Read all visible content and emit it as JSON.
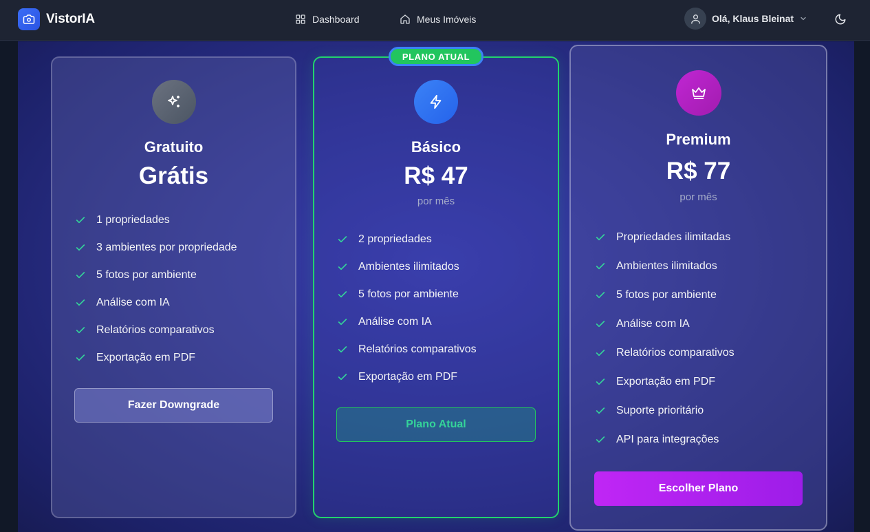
{
  "app": {
    "name": "VistorIA"
  },
  "nav": {
    "links": [
      {
        "label": "Dashboard",
        "icon": "grid-icon"
      },
      {
        "label": "Meus Imóveis",
        "icon": "home-icon"
      }
    ],
    "user": {
      "greeting": "Olá, Klaus Bleinat",
      "icon": "user-icon"
    },
    "theme_icon": "moon-icon"
  },
  "plans": [
    {
      "id": "free",
      "name": "Gratuito",
      "price": "Grátis",
      "period": "",
      "icon": "sparkles-icon",
      "features": [
        "1 propriedades",
        "3 ambientes por propriedade",
        "5 fotos por ambiente",
        "Análise com IA",
        "Relatórios comparativos",
        "Exportação em PDF"
      ],
      "button_label": "Fazer Downgrade"
    },
    {
      "id": "basic",
      "name": "Básico",
      "price": "R$ 47",
      "period": "por mês",
      "icon": "lightning-icon",
      "badge": "PLANO ATUAL",
      "features": [
        "2 propriedades",
        "Ambientes ilimitados",
        "5 fotos por ambiente",
        "Análise com IA",
        "Relatórios comparativos",
        "Exportação em PDF"
      ],
      "button_label": "Plano Atual"
    },
    {
      "id": "premium",
      "name": "Premium",
      "price": "R$ 77",
      "period": "por mês",
      "icon": "crown-icon",
      "features": [
        "Propriedades ilimitadas",
        "Ambientes ilimitados",
        "5 fotos por ambiente",
        "Análise com IA",
        "Relatórios comparativos",
        "Exportação em PDF",
        "Suporte prioritário",
        "API para integrações"
      ],
      "button_label": "Escolher Plano"
    }
  ],
  "colors": {
    "accent": "#3b6df6",
    "current": "#22c55e",
    "premium": "#c026d3",
    "check": "#34d399"
  }
}
